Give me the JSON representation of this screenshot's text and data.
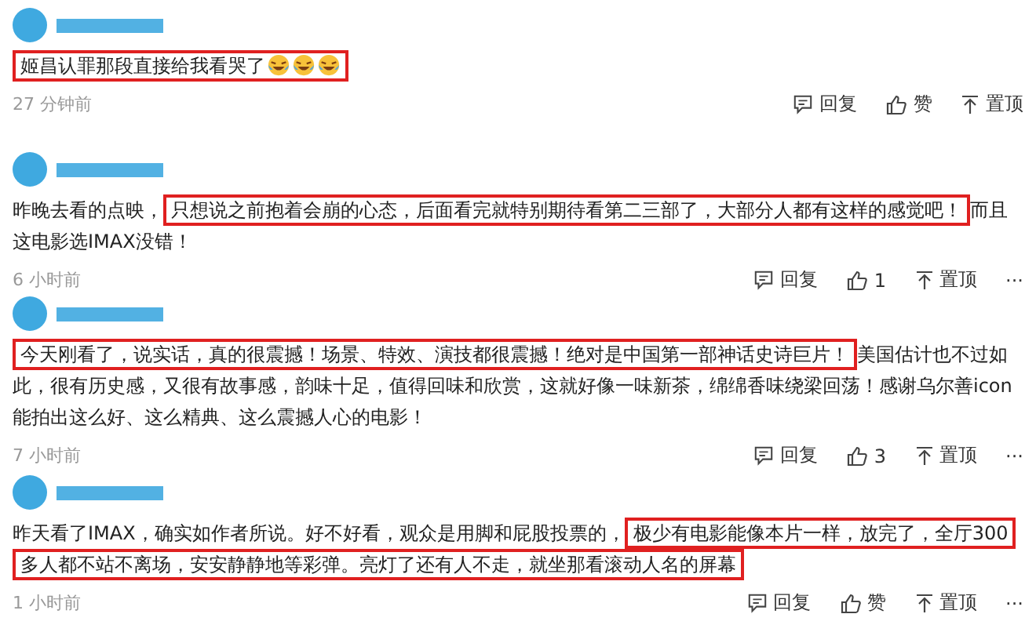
{
  "comments": [
    {
      "parts": [
        {
          "text": "姬昌认罪那段直接给我看哭了",
          "highlighted": true,
          "emojis": [
            {
              "kind": "laughing-crying"
            },
            {
              "kind": "laughing-crying"
            },
            {
              "kind": "laughing-crying"
            }
          ]
        }
      ],
      "time": "27 分钟前",
      "reply": "回复",
      "like": "赞",
      "pin": "置顶"
    },
    {
      "parts": [
        {
          "text": "昨晚去看的点映，",
          "highlighted": false
        },
        {
          "text": "只想说之前抱着会崩的心态，后面看完就特别期待看第二三部了，大部分人都有这样的感觉吧！",
          "highlighted": true
        },
        {
          "text": "而且这电影选IMAX没错！",
          "highlighted": false
        }
      ],
      "time": "6 小时前",
      "reply": "回复",
      "like": "1",
      "pin": "置顶",
      "more": "···"
    },
    {
      "parts": [
        {
          "text": "今天刚看了，说实话，真的很震撼！场景、特效、演技都很震撼！绝对是中国第一部神话史诗巨片！",
          "highlighted": true
        },
        {
          "text": "美国估计也不过如此，很有历史感，又很有故事感，韵味十足，值得回味和欣赏，这就好像一味新茶，绵绵香味绕梁回荡！感谢乌尔善icon能拍出这么好、这么精典、这么震撼人心的电影！",
          "highlighted": false
        }
      ],
      "time": "7 小时前",
      "reply": "回复",
      "like": "3",
      "pin": "置顶",
      "more": "···"
    },
    {
      "parts": [
        {
          "text": "昨天看了IMAX，确实如作者所说。好不好看，观众是用脚和屁股投票的，",
          "highlighted": false
        },
        {
          "text": "极少有电影能像本片一样，放完了，全厅300多人都不站不离场，安安静静地等彩弹。亮灯了还有人不走，就坐那看滚动人名的屏幕",
          "highlighted": true
        }
      ],
      "time": "1 小时前",
      "reply": "回复",
      "like": "赞",
      "pin": "置顶",
      "more": "···"
    }
  ]
}
